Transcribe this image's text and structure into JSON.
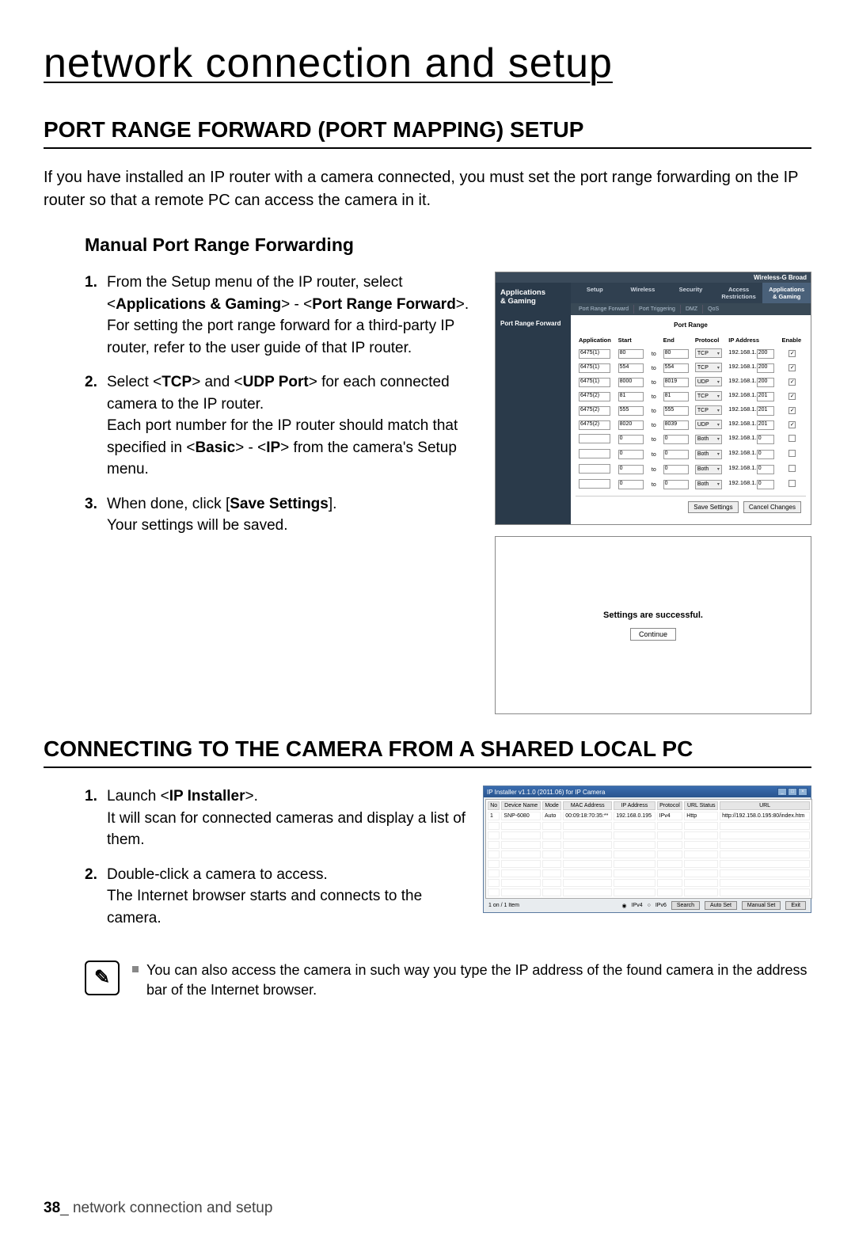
{
  "chapter_title": "network connection and setup",
  "section1_heading": "PORT RANGE FORWARD (PORT MAPPING) SETUP",
  "intro": "If you have installed an IP router with a camera connected, you must set the port range forwarding on the IP router so that a remote PC can access the camera in it.",
  "sub1": "Manual Port Range Forwarding",
  "steps1": {
    "s1a": "From the Setup menu of the IP router, select <",
    "s1b": "Applications & Gaming",
    "s1c": "> - <",
    "s1d": "Port Range Forward",
    "s1e": ">.",
    "s1f": "For setting the port range forward for a third-party IP router, refer to the user guide of that IP router.",
    "s2a": "Select <",
    "s2b": "TCP",
    "s2c": "> and <",
    "s2d": "UDP Port",
    "s2e": "> for each connected camera to the IP router.",
    "s2f": "Each port number for the IP router should match that specified in <",
    "s2g": "Basic",
    "s2h": "> - <",
    "s2i": "IP",
    "s2j": "> from the camera's Setup menu.",
    "s3a": "When done, click [",
    "s3b": "Save Settings",
    "s3c": "].",
    "s3d": "Your settings will be saved."
  },
  "router": {
    "brand": "Wireless-G Broad",
    "sidelabel": "Applications\n& Gaming",
    "toptabs": [
      "Setup",
      "Wireless",
      "Security",
      "Access Restrictions",
      "Applications & Gaming"
    ],
    "subtabs": [
      "Port Range Forward",
      "Port Triggering",
      "DMZ",
      "QoS"
    ],
    "leftbar": "Port Range Forward",
    "tableheading": "Port Range",
    "cols": [
      "Application",
      "Start",
      "End",
      "Protocol",
      "IP Address",
      "Enable"
    ],
    "ip_prefix": "192.168.1.",
    "to_label": "to",
    "rows": [
      {
        "app": "6475(1)",
        "start": "80",
        "end": "80",
        "proto": "TCP",
        "ip": "200",
        "en": true
      },
      {
        "app": "6475(1)",
        "start": "554",
        "end": "554",
        "proto": "TCP",
        "ip": "200",
        "en": true
      },
      {
        "app": "6475(1)",
        "start": "8000",
        "end": "8019",
        "proto": "UDP",
        "ip": "200",
        "en": true
      },
      {
        "app": "6475(2)",
        "start": "81",
        "end": "81",
        "proto": "TCP",
        "ip": "201",
        "en": true
      },
      {
        "app": "6475(2)",
        "start": "555",
        "end": "555",
        "proto": "TCP",
        "ip": "201",
        "en": true
      },
      {
        "app": "6475(2)",
        "start": "8020",
        "end": "8039",
        "proto": "UDP",
        "ip": "201",
        "en": true
      },
      {
        "app": "",
        "start": "0",
        "end": "0",
        "proto": "Both",
        "ip": "0",
        "en": false
      },
      {
        "app": "",
        "start": "0",
        "end": "0",
        "proto": "Both",
        "ip": "0",
        "en": false
      },
      {
        "app": "",
        "start": "0",
        "end": "0",
        "proto": "Both",
        "ip": "0",
        "en": false
      },
      {
        "app": "",
        "start": "0",
        "end": "0",
        "proto": "Both",
        "ip": "0",
        "en": false
      }
    ],
    "save": "Save Settings",
    "cancel": "Cancel Changes"
  },
  "success": {
    "msg": "Settings are successful.",
    "btn": "Continue"
  },
  "section2_heading": "CONNECTING TO THE CAMERA FROM A SHARED LOCAL PC",
  "steps2": {
    "s1a": "Launch <",
    "s1b": "IP Installer",
    "s1c": ">.",
    "s1d": "It will scan for connected cameras and display a list of them.",
    "s2a": "Double-click a camera to access.",
    "s2b": "The Internet browser starts and connects to the camera."
  },
  "ipinst": {
    "title": "IP Installer v1.1.0 (2011.06) for IP Camera",
    "cols": [
      "No",
      "Device Name",
      "Mode",
      "MAC Address",
      "IP Address",
      "Protocol",
      "URL Status",
      "URL"
    ],
    "row": [
      "1",
      "SNP-6080",
      "Auto",
      "00:09:18:70:35:**",
      "192.168.0.195",
      "IPv4",
      "Http",
      "http://192.158.0.195:80/index.htm"
    ],
    "footer": {
      "count": "1 on / 1 Item",
      "ipv4": "IPv4",
      "ipv6": "IPv6",
      "search": "Search",
      "autoset": "Auto Set",
      "manualset": "Manual Set",
      "exit": "Exit"
    }
  },
  "note": "You can also access the camera in such way you type the IP address of the found camera in the address bar of the Internet browser.",
  "footer_page": "38",
  "footer_label": "_ network connection and setup"
}
